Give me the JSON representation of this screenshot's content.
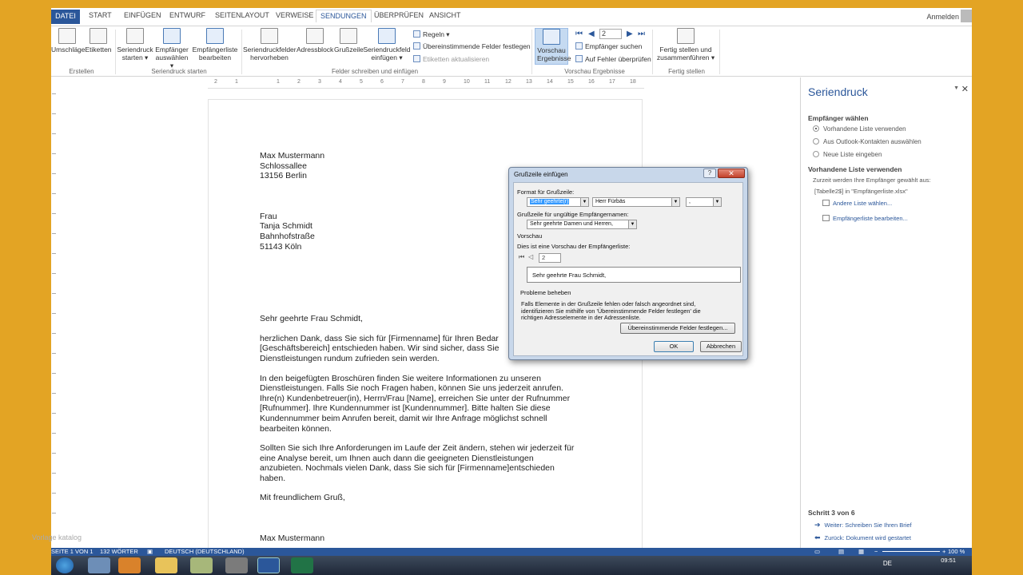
{
  "tabs": {
    "file": "DATEI",
    "start": "START",
    "insert": "EINFÜGEN",
    "design": "ENTWURF",
    "layout": "SEITENLAYOUT",
    "references": "VERWEISE",
    "mailings": "SENDUNGEN",
    "review": "ÜBERPRÜFEN",
    "view": "ANSICHT",
    "login": "Anmelden"
  },
  "ribbon": {
    "envelopes": "Umschläge",
    "labels": "Etiketten",
    "start_merge_1": "Seriendruck",
    "start_merge_2": "starten ▾",
    "select_rec_1": "Empfänger",
    "select_rec_2": "auswählen ▾",
    "edit_list_1": "Empfängerliste",
    "edit_list_2": "bearbeiten",
    "highlight_1": "Seriendruckfelder",
    "highlight_2": "hervorheben",
    "address_block": "Adressblock",
    "greeting_line": "Grußzeile",
    "insert_field_1": "Seriendruckfeld",
    "insert_field_2": "einfügen ▾",
    "rules": "Regeln ▾",
    "match_fields": "Übereinstimmende Felder festlegen",
    "update_labels": "Etiketten aktualisieren",
    "preview_1": "Vorschau",
    "preview_2": "Ergebnisse",
    "record_number": "2",
    "find_recipient": "Empfänger suchen",
    "check_errors": "Auf Fehler überprüfen",
    "finish_1": "Fertig stellen und",
    "finish_2": "zusammenführen ▾",
    "group_create": "Erstellen",
    "group_start": "Seriendruck starten",
    "group_fields": "Felder schreiben und einfügen",
    "group_preview": "Vorschau Ergebnisse",
    "group_finish": "Fertig stellen"
  },
  "ruler": [
    "2",
    "1",
    "1",
    "2",
    "3",
    "4",
    "5",
    "6",
    "7",
    "8",
    "9",
    "10",
    "11",
    "12",
    "13",
    "14",
    "15",
    "16",
    "17",
    "18"
  ],
  "letter": {
    "sender": "Max Mustermann\nSchlossallee\n13156 Berlin",
    "recipient": "Frau\nTanja Schmidt\nBahnhofstraße\n51143 Köln",
    "greeting": "Sehr geehrte Frau Schmidt,",
    "p1": "herzlichen Dank, dass Sie sich für [Firmenname] für Ihren Bedar\n[Geschäftsbereich] entschieden haben. Wir sind sicher, dass Sie\nDienstleistungen rundum zufrieden sein werden.",
    "p2": "In den beigefügten Broschüren finden Sie weitere Informationen zu unseren\nDienstleistungen. Falls Sie noch Fragen haben, können Sie uns jederzeit anrufen.\nIhre(n) Kundenbetreuer(in), Herrn/Frau [Name], erreichen Sie unter der Rufnummer\n[Rufnummer]. Ihre Kundennummer ist [Kundennummer]. Bitte halten Sie diese\nKundennummer beim Anrufen bereit, damit wir Ihre Anfrage möglichst schnell\nbearbeiten können.",
    "p3": "Sollten Sie sich Ihre Anforderungen im Laufe der Zeit ändern, stehen wir jederzeit für\neine Analyse bereit, um Ihnen auch dann die geeigneten Dienstleistungen\nanzubieten. Nochmals vielen Dank, dass Sie sich für [Firmenname]entschieden\nhaben.",
    "closing": "Mit freundlichem Gruß,",
    "signature": "Max Mustermann"
  },
  "watermark": "Vorlage katalog",
  "dialog": {
    "title": "Grußzeile einfügen",
    "help": "?",
    "close": "✕",
    "format_label": "Format für Grußzeile:",
    "salutation": "Sehr geehrte(r)",
    "name_format": "Herr Fürbäs",
    "punctuation": ",",
    "invalid_label": "Grußzeile für ungültige Empfängernamen:",
    "invalid_value": "Sehr geehrte Damen und Herren,",
    "preview_header": "Vorschau",
    "preview_label": "Dies ist eine Vorschau der Empfängerliste:",
    "record": "2",
    "preview_text": "Sehr geehrte Frau Schmidt,",
    "trouble_header": "Probleme beheben",
    "trouble_text": "Falls Elemente in der Grußzeile fehlen oder falsch angeordnet sind,\nidentifizieren Sie mithilfe von 'Übereinstimmende Felder festlegen' die\nrichtigen Adresselemente in der Adressenliste.",
    "match_button": "Übereinstimmende Felder festlegen...",
    "ok": "OK",
    "cancel": "Abbrechen"
  },
  "pane": {
    "title": "Seriendruck",
    "close": "✕",
    "select_header": "Empfänger wählen",
    "opt1": "Vorhandene Liste verwenden",
    "opt2": "Aus Outlook-Kontakten auswählen",
    "opt3": "Neue Liste eingeben",
    "existing_header": "Vorhandene Liste verwenden",
    "info1": "Zurzeit werden Ihre Empfänger gewählt aus:",
    "info2": "[Tabelle2$] in \"Empfängerliste.xlsx\"",
    "link1": "Andere Liste wählen...",
    "link2": "Empfängerliste bearbeiten...",
    "step": "Schritt 3 von 6",
    "next": "Weiter: Schreiben Sie Ihren Brief",
    "back": "Zurück: Dokument wird gestartet"
  },
  "status": {
    "page": "SEITE 1 VON 1",
    "words": "132 WÖRTER",
    "lang": "DEUTSCH (DEUTSCHLAND)",
    "zoom": "100 %"
  },
  "taskbar": {
    "lang": "DE",
    "time": "09:51"
  },
  "colors": {
    "accent": "#2b579a",
    "background": "#e3a424"
  }
}
